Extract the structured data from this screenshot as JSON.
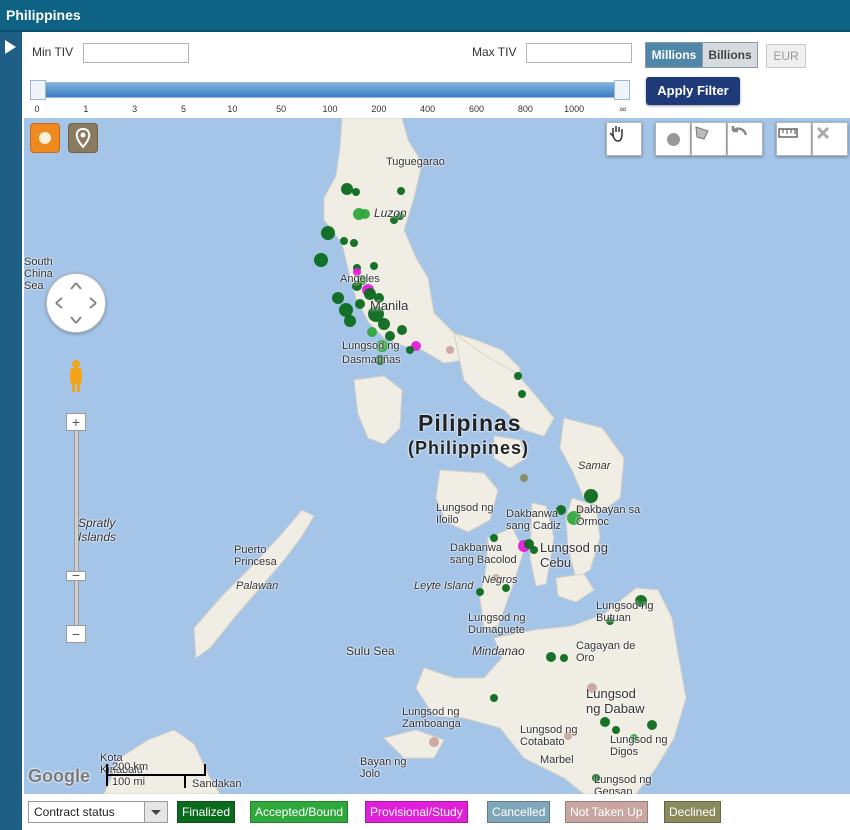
{
  "window": {
    "title": "Philippines"
  },
  "filter": {
    "min_label": "Min TIV",
    "max_label": "Max TIV",
    "min_value": "",
    "max_value": "",
    "unit_millions": "Millions",
    "unit_billions": "Billions",
    "currency": "EUR",
    "apply_label": "Apply Filter",
    "slider_ticks": [
      "0",
      "1",
      "3",
      "5",
      "10",
      "50",
      "100",
      "200",
      "400",
      "600",
      "800",
      "1000",
      "∞"
    ],
    "slider_range": [
      "0",
      "∞"
    ]
  },
  "map_controls": {
    "icons": [
      "sun-icon",
      "location-pin-icon",
      "pan-hand-icon",
      "draw-circle-icon",
      "draw-polygon-icon",
      "undo-icon",
      "measure-ruler-icon",
      "clear-icon",
      "streetview-pegman-icon",
      "zoom-in-icon",
      "zoom-out-icon"
    ]
  },
  "map": {
    "country_label": "Pilipinas",
    "country_label_en": "(Philippines)",
    "places": [
      "Tuguegarao",
      "Luzon",
      "Angeles",
      "Manila",
      "Lungsod ng",
      "Dasmariñas",
      "Samar",
      "Dakbayan sa Ormoc",
      "Lungsod ng Iloilo",
      "Dakbanwa sang Cadiz",
      "Dakbanwa sang Bacolod",
      "Lungsod ng Cebu",
      "Negros",
      "Leyte Island",
      "Lungsod ng Dumaguete",
      "Mindanao",
      "Lungsod ng Butuan",
      "Cagayan de Oro",
      "Lungsod ng Dabaw",
      "Lungsod ng Zamboanga",
      "Lungsod ng Cotabato",
      "Lungsod ng Digos",
      "Marbel",
      "Lungsod ng Gensan",
      "Bayan ng Jolo",
      "Sulu Sea",
      "Puerto Princesa",
      "Palawan",
      "Spratly Islands",
      "South China Sea",
      "Kota Kinabalu",
      "Sandakan"
    ],
    "scale": {
      "km": "200 km",
      "mi": "100 mi"
    },
    "attribution": "Google"
  },
  "legend": {
    "select_value": "Contract status",
    "items": [
      {
        "label": "Finalized",
        "color": "#0b6b1d"
      },
      {
        "label": "Accepted/Bound",
        "color": "#2fa83c"
      },
      {
        "label": "Provisional/Study",
        "color": "#e020d8"
      },
      {
        "label": "Cancelled",
        "color": "#7fa6b9"
      },
      {
        "label": "Not Taken Up",
        "color": "#caa6a0"
      },
      {
        "label": "Declined",
        "color": "#8a8a5c"
      }
    ]
  },
  "colors": {
    "title_bar": "#0e6283",
    "sidebar": "#1f5f86",
    "sea": "#a4c4e8",
    "land": "#f0ede5"
  }
}
